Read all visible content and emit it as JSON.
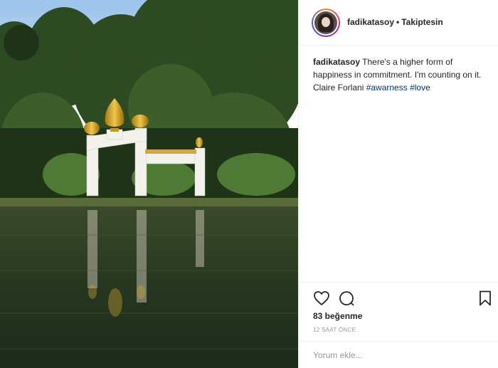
{
  "header": {
    "username": "fadikatasoy",
    "separator": "•",
    "follow_status": "Takiptesin"
  },
  "caption": {
    "username": "fadikatasoy",
    "text": "There's a higher form of happiness in commitment. I'm counting on it. Claire Forlani",
    "hashtags": [
      "#awarness",
      "#love"
    ]
  },
  "actions": {
    "icons": [
      "heart-icon",
      "comment-icon",
      "bookmark-icon"
    ],
    "likes_text": "83 beğenme",
    "time_text": "12 SAAT ÖNCE"
  },
  "comment": {
    "placeholder": "Yorum ekle..."
  },
  "colors": {
    "hashtag": "#003569",
    "border": "#efefef",
    "muted": "#999999"
  }
}
